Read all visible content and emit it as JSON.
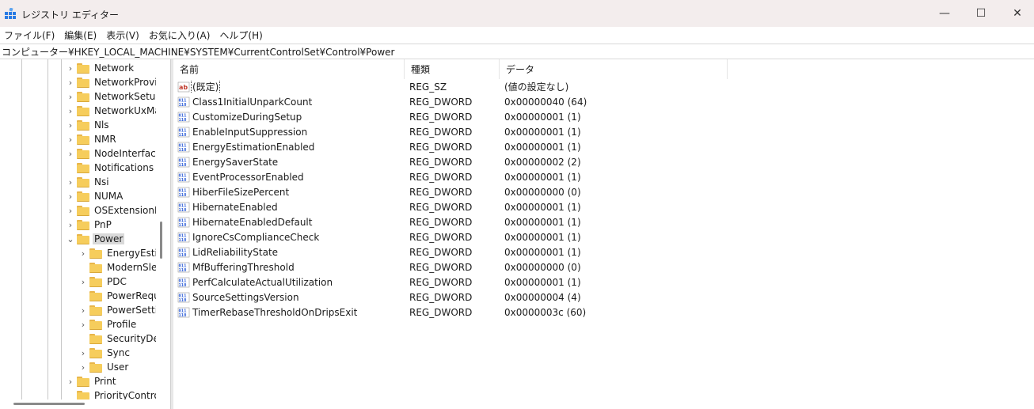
{
  "window": {
    "title": "レジストリ エディター",
    "min_icon": "minimize-icon",
    "max_icon": "maximize-icon",
    "close_icon": "close-icon",
    "min_glyph": "—",
    "max_glyph": "☐",
    "close_glyph": "✕"
  },
  "menu": [
    "ファイル(F)",
    "編集(E)",
    "表示(V)",
    "お気に入り(A)",
    "ヘルプ(H)"
  ],
  "address": "コンピューター¥HKEY_LOCAL_MACHINE¥SYSTEM¥CurrentControlSet¥Control¥Power",
  "tree": {
    "items": [
      {
        "label": "Network",
        "chevron": "›"
      },
      {
        "label": "NetworkProvid",
        "chevron": "›"
      },
      {
        "label": "NetworkSetup",
        "chevron": "›"
      },
      {
        "label": "NetworkUxMa",
        "chevron": "›"
      },
      {
        "label": "Nls",
        "chevron": "›"
      },
      {
        "label": "NMR",
        "chevron": "›"
      },
      {
        "label": "NodeInterface",
        "chevron": "›"
      },
      {
        "label": "Notifications",
        "chevron": ""
      },
      {
        "label": "Nsi",
        "chevron": "›"
      },
      {
        "label": "NUMA",
        "chevron": "›"
      },
      {
        "label": "OSExtensionD",
        "chevron": "›"
      },
      {
        "label": "PnP",
        "chevron": "›"
      },
      {
        "label": "Power",
        "chevron": "⌄"
      },
      {
        "label": "EnergyEstim",
        "chevron": "›"
      },
      {
        "label": "ModernSlee",
        "chevron": ""
      },
      {
        "label": "PDC",
        "chevron": "›"
      },
      {
        "label": "PowerRequ",
        "chevron": ""
      },
      {
        "label": "PowerSettin",
        "chevron": "›"
      },
      {
        "label": "Profile",
        "chevron": "›"
      },
      {
        "label": "SecurityDes",
        "chevron": ""
      },
      {
        "label": "Sync",
        "chevron": "›"
      },
      {
        "label": "User",
        "chevron": "›"
      },
      {
        "label": "Print",
        "chevron": "›"
      },
      {
        "label": "PriorityContro",
        "chevron": ""
      }
    ]
  },
  "list": {
    "headers": {
      "name": "名前",
      "type": "種類",
      "data": "データ"
    },
    "rows": [
      {
        "name": "(既定)",
        "type": "REG_SZ",
        "data": "(値の設定なし)",
        "icon": "string-value-icon"
      },
      {
        "name": "Class1InitialUnparkCount",
        "type": "REG_DWORD",
        "data": "0x00000040 (64)",
        "icon": "dword-value-icon"
      },
      {
        "name": "CustomizeDuringSetup",
        "type": "REG_DWORD",
        "data": "0x00000001 (1)",
        "icon": "dword-value-icon"
      },
      {
        "name": "EnableInputSuppression",
        "type": "REG_DWORD",
        "data": "0x00000001 (1)",
        "icon": "dword-value-icon"
      },
      {
        "name": "EnergyEstimationEnabled",
        "type": "REG_DWORD",
        "data": "0x00000001 (1)",
        "icon": "dword-value-icon"
      },
      {
        "name": "EnergySaverState",
        "type": "REG_DWORD",
        "data": "0x00000002 (2)",
        "icon": "dword-value-icon"
      },
      {
        "name": "EventProcessorEnabled",
        "type": "REG_DWORD",
        "data": "0x00000001 (1)",
        "icon": "dword-value-icon"
      },
      {
        "name": "HiberFileSizePercent",
        "type": "REG_DWORD",
        "data": "0x00000000 (0)",
        "icon": "dword-value-icon"
      },
      {
        "name": "HibernateEnabled",
        "type": "REG_DWORD",
        "data": "0x00000001 (1)",
        "icon": "dword-value-icon"
      },
      {
        "name": "HibernateEnabledDefault",
        "type": "REG_DWORD",
        "data": "0x00000001 (1)",
        "icon": "dword-value-icon"
      },
      {
        "name": "IgnoreCsComplianceCheck",
        "type": "REG_DWORD",
        "data": "0x00000001 (1)",
        "icon": "dword-value-icon"
      },
      {
        "name": "LidReliabilityState",
        "type": "REG_DWORD",
        "data": "0x00000001 (1)",
        "icon": "dword-value-icon"
      },
      {
        "name": "MfBufferingThreshold",
        "type": "REG_DWORD",
        "data": "0x00000000 (0)",
        "icon": "dword-value-icon"
      },
      {
        "name": "PerfCalculateActualUtilization",
        "type": "REG_DWORD",
        "data": "0x00000001 (1)",
        "icon": "dword-value-icon"
      },
      {
        "name": "SourceSettingsVersion",
        "type": "REG_DWORD",
        "data": "0x00000004 (4)",
        "icon": "dword-value-icon"
      },
      {
        "name": "TimerRebaseThresholdOnDripsExit",
        "type": "REG_DWORD",
        "data": "0x0000003c (60)",
        "icon": "dword-value-icon"
      }
    ]
  },
  "colors": {
    "titlebar_bg": "#f3eded",
    "folder": "#f6cd5c",
    "selection": "#d9d9d9",
    "dword_icon_blue": "#2a5bd7",
    "string_icon_red": "#c0392b"
  }
}
